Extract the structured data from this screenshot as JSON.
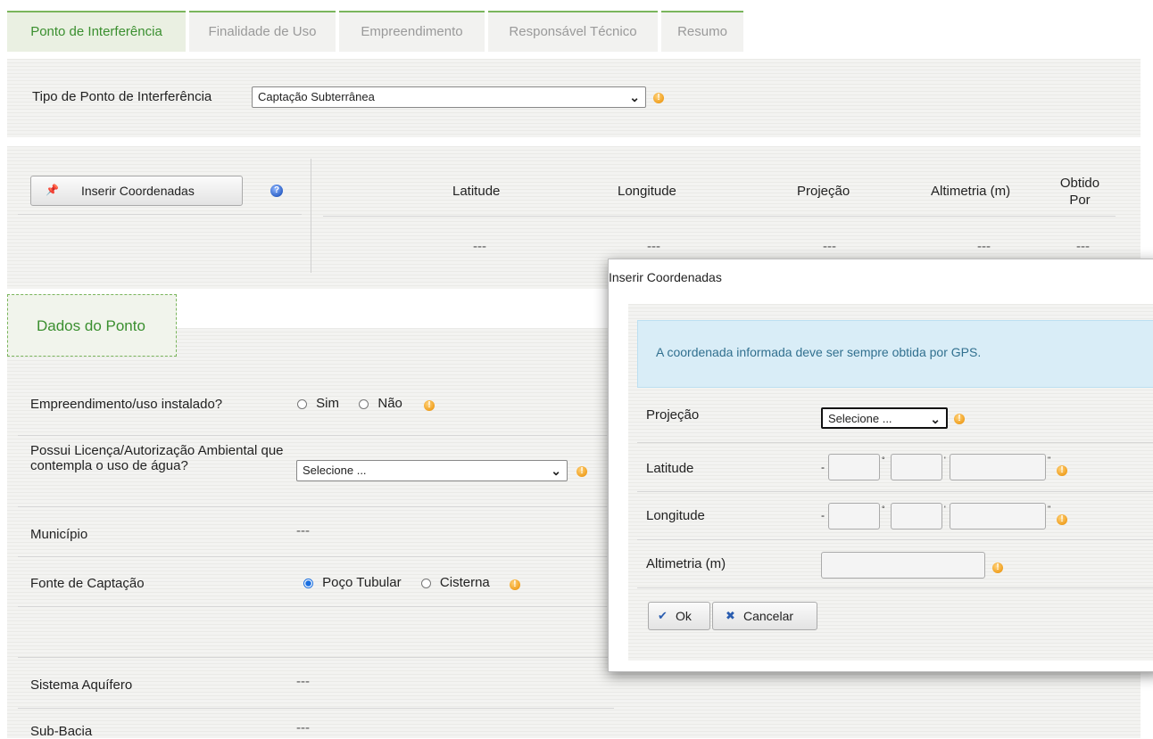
{
  "tabs": [
    {
      "label": "Ponto de Interferência"
    },
    {
      "label": "Finalidade de Uso"
    },
    {
      "label": "Empreendimento"
    },
    {
      "label": "Responsável Técnico"
    },
    {
      "label": "Resumo"
    }
  ],
  "tipo_ponto": {
    "label": "Tipo de Ponto de Interferência",
    "value": "Captação Subterrânea"
  },
  "coordinates": {
    "insert_button": "Inserir Coordenadas",
    "columns": [
      "Latitude",
      "Longitude",
      "Projeção",
      "Altimetria (m)",
      "Obtido Por"
    ],
    "row": [
      "---",
      "---",
      "---",
      "---",
      "---"
    ]
  },
  "section_title": "Dados do Ponto",
  "fields": {
    "empreendimento_label": "Empreendimento/uso instalado?",
    "sim": "Sim",
    "nao": "Não",
    "licenca_label": "Possui Licença/Autorização Ambiental que contempla o uso de água?",
    "licenca_value": "Selecione ...",
    "municipio_label": "Município",
    "municipio_value": "---",
    "fonte_label": "Fonte de Captação",
    "poco": "Poço Tubular",
    "cisterna": "Cisterna",
    "aquifero_label": "Sistema Aquífero",
    "aquifero_value": "---",
    "subbacia_label": "Sub-Bacia",
    "subbacia_value": "---"
  },
  "dialog": {
    "title": "Inserir Coordenadas",
    "info": "A coordenada informada deve ser sempre obtida por GPS.",
    "projecao_label": "Projeção",
    "projecao_value": "Selecione ...",
    "latitude_label": "Latitude",
    "longitude_label": "Longitude",
    "altimetria_label": "Altimetria (m)",
    "sign": "-",
    "ok": "Ok",
    "cancel": "Cancelar"
  },
  "colors": {
    "accent_green": "#3a8f2f",
    "info_bg": "#d9edf7",
    "info_text": "#31708f"
  }
}
